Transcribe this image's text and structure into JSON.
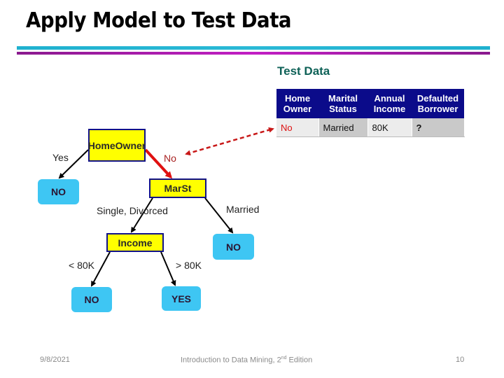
{
  "slide": {
    "title": "Apply Model to Test Data",
    "page_number": "10",
    "date": "9/8/2021",
    "footer_text": "Introduction to Data Mining, 2",
    "footer_superscript": "nd",
    "footer_suffix": " Edition"
  },
  "test_data": {
    "title": "Test Data",
    "headers": [
      [
        "Home",
        "Owner"
      ],
      [
        "Marital",
        "Status"
      ],
      [
        "Annual",
        "Income"
      ],
      [
        "Defaulted",
        "Borrower"
      ]
    ],
    "row": [
      "No",
      "Married",
      "80K",
      "?"
    ]
  },
  "tree": {
    "root": {
      "label_line1": "Home",
      "label_line2": "Owner"
    },
    "marst": {
      "label": "MarSt"
    },
    "income": {
      "label": "Income"
    },
    "leaves": {
      "home_yes": "NO",
      "married": "NO",
      "income_low": "NO",
      "income_high": "YES"
    },
    "edges": {
      "home_yes": "Yes",
      "home_no": "No",
      "single_divorced": "Single, Divorced",
      "married": "Married",
      "income_low": "< 80K",
      "income_high": "> 80K"
    }
  },
  "colors": {
    "split_fill": "#ffff00",
    "split_border": "#121288",
    "leaf_fill": "#3ec6f3",
    "active_path": "#e01010",
    "table_header": "#0b0b8a"
  }
}
